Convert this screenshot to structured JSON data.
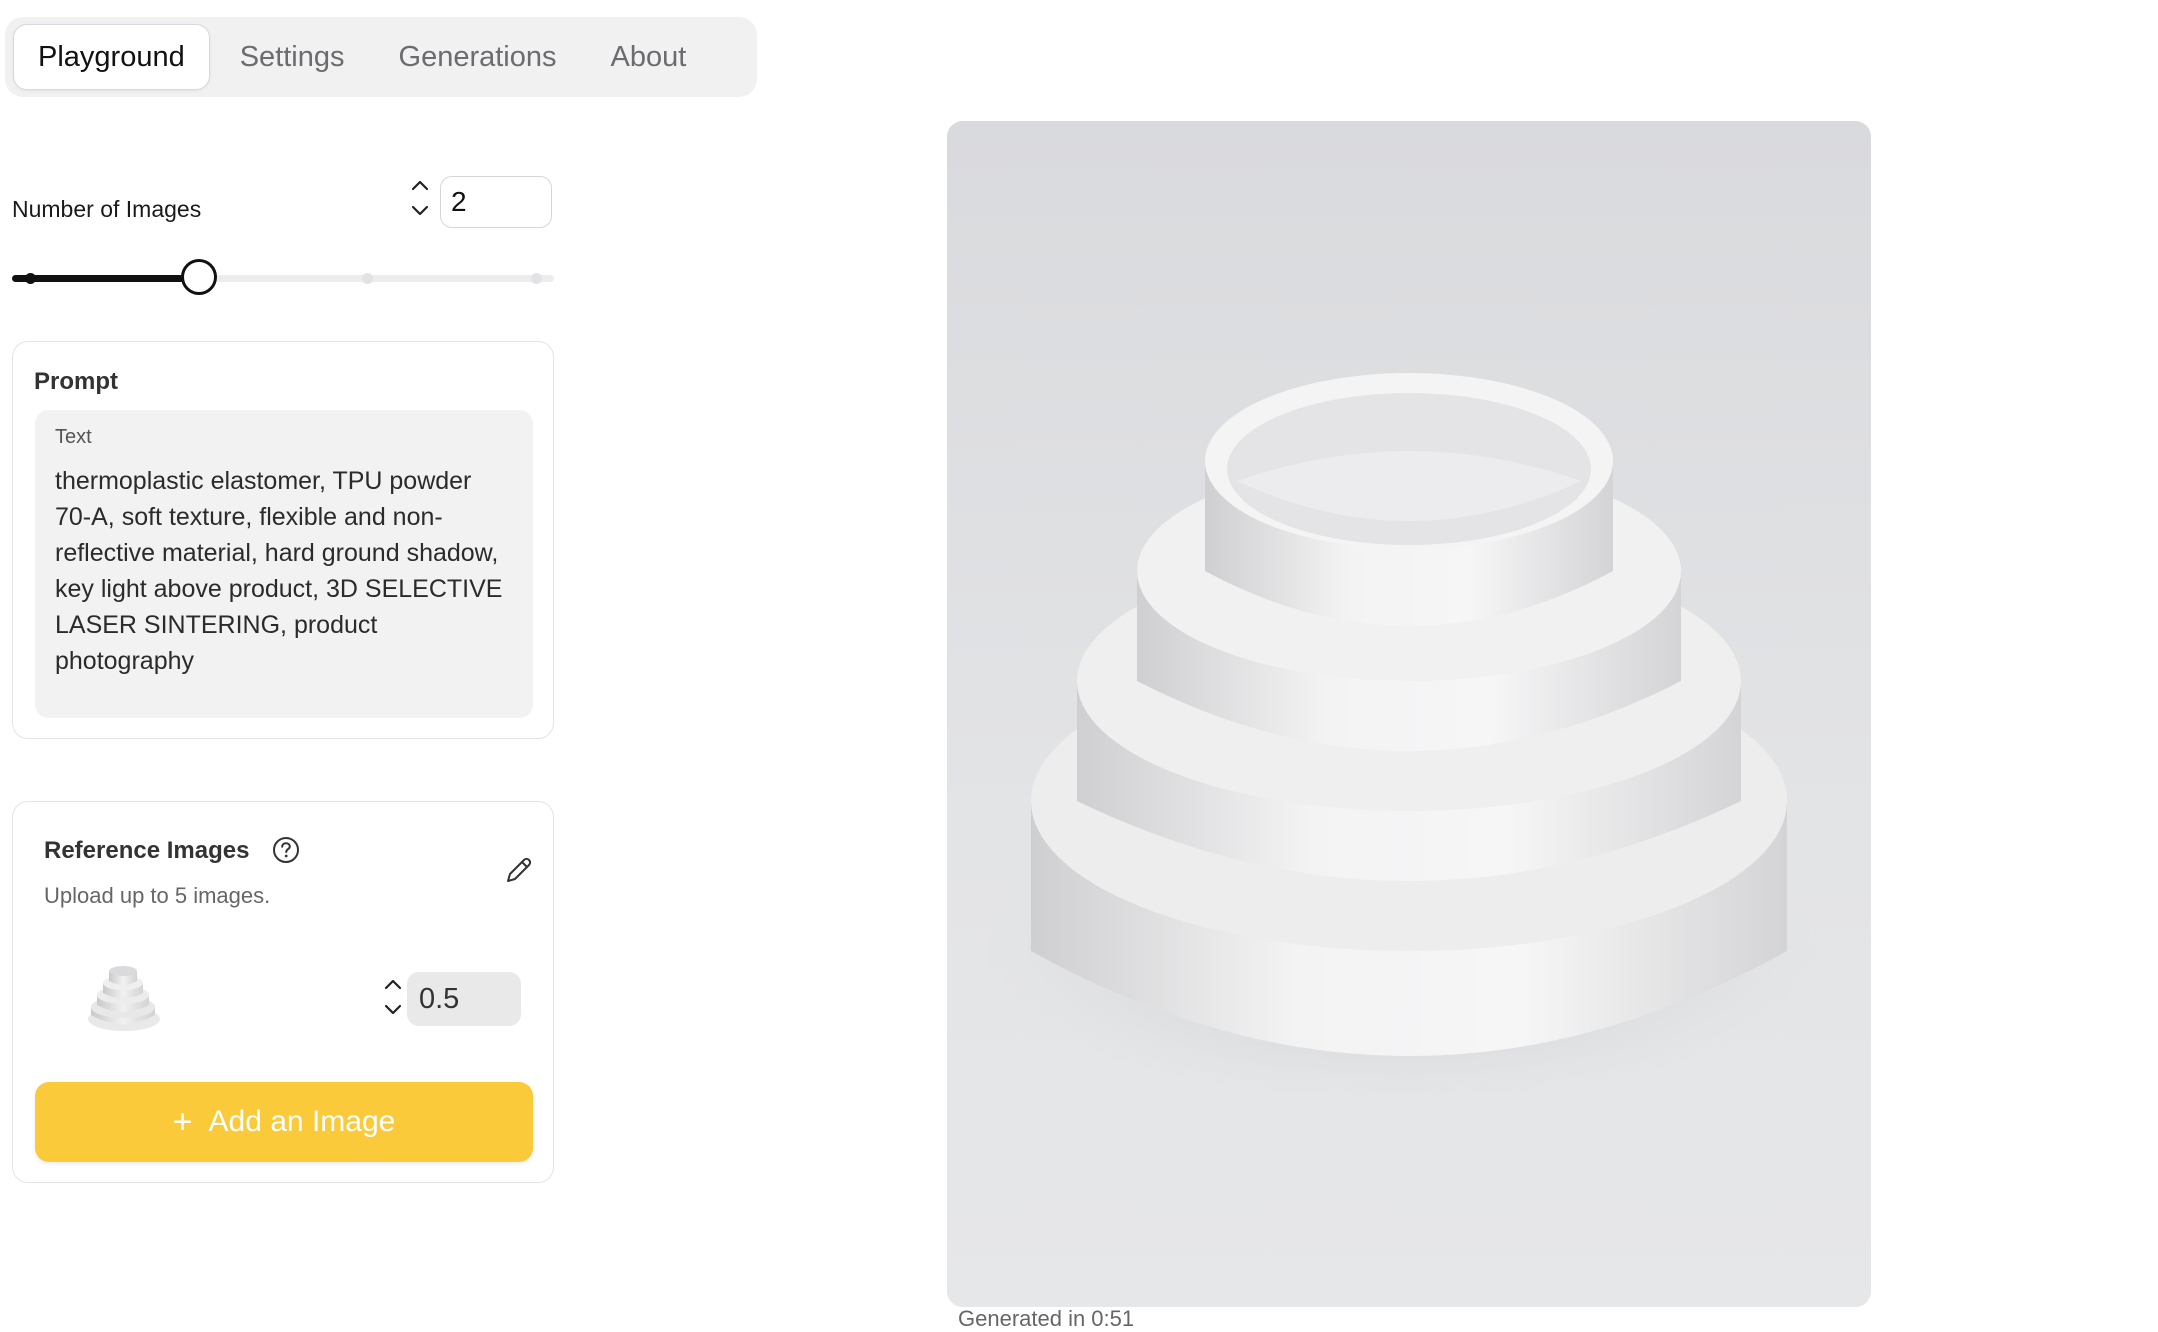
{
  "tabs": [
    {
      "label": "Playground",
      "active": true
    },
    {
      "label": "Settings",
      "active": false
    },
    {
      "label": "Generations",
      "active": false
    },
    {
      "label": "About",
      "active": false
    }
  ],
  "num_images": {
    "label": "Number of Images",
    "value": "2",
    "slider": {
      "min": 1,
      "max": 4,
      "value": 2
    }
  },
  "prompt": {
    "title": "Prompt",
    "field_label": "Text",
    "text": "thermoplastic elastomer, TPU powder 70-A, soft texture, flexible and non-reflective material, hard ground shadow, key light above product, 3D SELECTIVE LASER SINTERING, product photography"
  },
  "reference_images": {
    "title": "Reference Images",
    "subtitle": "Upload up to 5 images.",
    "items": [
      {
        "weight": "0.5"
      }
    ],
    "add_button": "Add an Image",
    "help_icon": "question-circle-icon",
    "edit_icon": "pencil-icon"
  },
  "output": {
    "caption": "Generated in 0:51"
  },
  "colors": {
    "accent": "#fbca3b",
    "slider": "#111111",
    "panel_bg": "#f1f1f2"
  }
}
